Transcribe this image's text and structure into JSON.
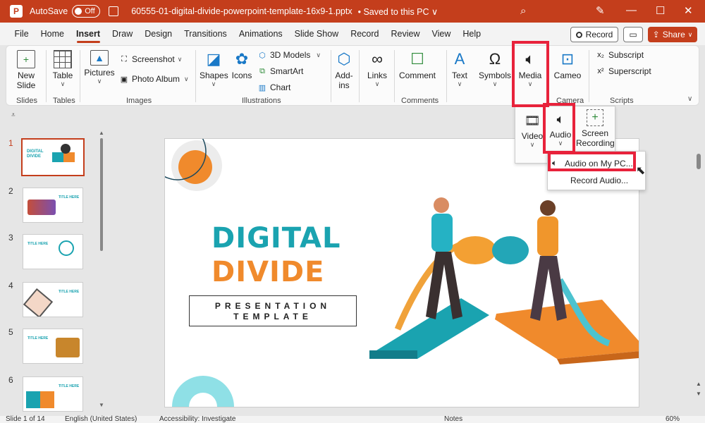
{
  "titlebar": {
    "autosave_label": "AutoSave",
    "autosave_state": "Off",
    "filename": "60555-01-digital-divide-powerpoint-template-16x9-1.pptx",
    "save_status": "• Saved to this PC ∨"
  },
  "menu": {
    "tabs": [
      "File",
      "Home",
      "Insert",
      "Draw",
      "Design",
      "Transitions",
      "Animations",
      "Slide Show",
      "Record",
      "Review",
      "View",
      "Help"
    ],
    "active": "Insert",
    "record_label": "Record",
    "share_label": "Share"
  },
  "ribbon": {
    "new_slide": "New Slide",
    "table": "Table",
    "pictures": "Pictures",
    "screenshot": "Screenshot",
    "photo_album": "Photo Album",
    "shapes": "Shapes",
    "icons": "Icons",
    "models_3d": "3D Models",
    "smartart": "SmartArt",
    "chart": "Chart",
    "addins": "Add-ins",
    "links": "Links",
    "comment": "Comment",
    "text": "Text",
    "symbols": "Symbols",
    "media": "Media",
    "cameo": "Cameo",
    "subscript": "Subscript",
    "superscript": "Superscript",
    "groups": {
      "slides": "Slides",
      "tables": "Tables",
      "images": "Images",
      "illustrations": "Illustrations",
      "comments": "Comments",
      "camera": "Camera",
      "scripts": "Scripts"
    }
  },
  "media_dropdown": {
    "video": "Video",
    "audio": "Audio",
    "screen_recording": "Screen Recording"
  },
  "audio_menu": {
    "audio_on_pc": "Audio on My PC...",
    "record_audio": "Record Audio..."
  },
  "thumbnails": [
    {
      "num": "1",
      "title": "DIGITAL DIVIDE"
    },
    {
      "num": "2",
      "title": "TITLE HERE"
    },
    {
      "num": "3",
      "title": "TITLE HERE"
    },
    {
      "num": "4",
      "title": "TITLE HERE"
    },
    {
      "num": "5",
      "title": "TITLE HERE"
    },
    {
      "num": "6",
      "title": "TITLE HERE"
    }
  ],
  "slide": {
    "title_line1": "DIGITAL",
    "title_line2": "DIVIDE",
    "subtitle_line1": "PRESENTATION",
    "subtitle_line2": "TEMPLATE"
  },
  "statusbar": {
    "slide_info": "Slide 1 of 14",
    "language": "English (United States)",
    "accessibility": "Accessibility: Investigate",
    "notes": "Notes",
    "zoom": "60%"
  },
  "colors": {
    "accent": "#c43e1c",
    "highlight": "#e8223b",
    "teal": "#1aa3b0",
    "orange": "#f08a2c"
  }
}
